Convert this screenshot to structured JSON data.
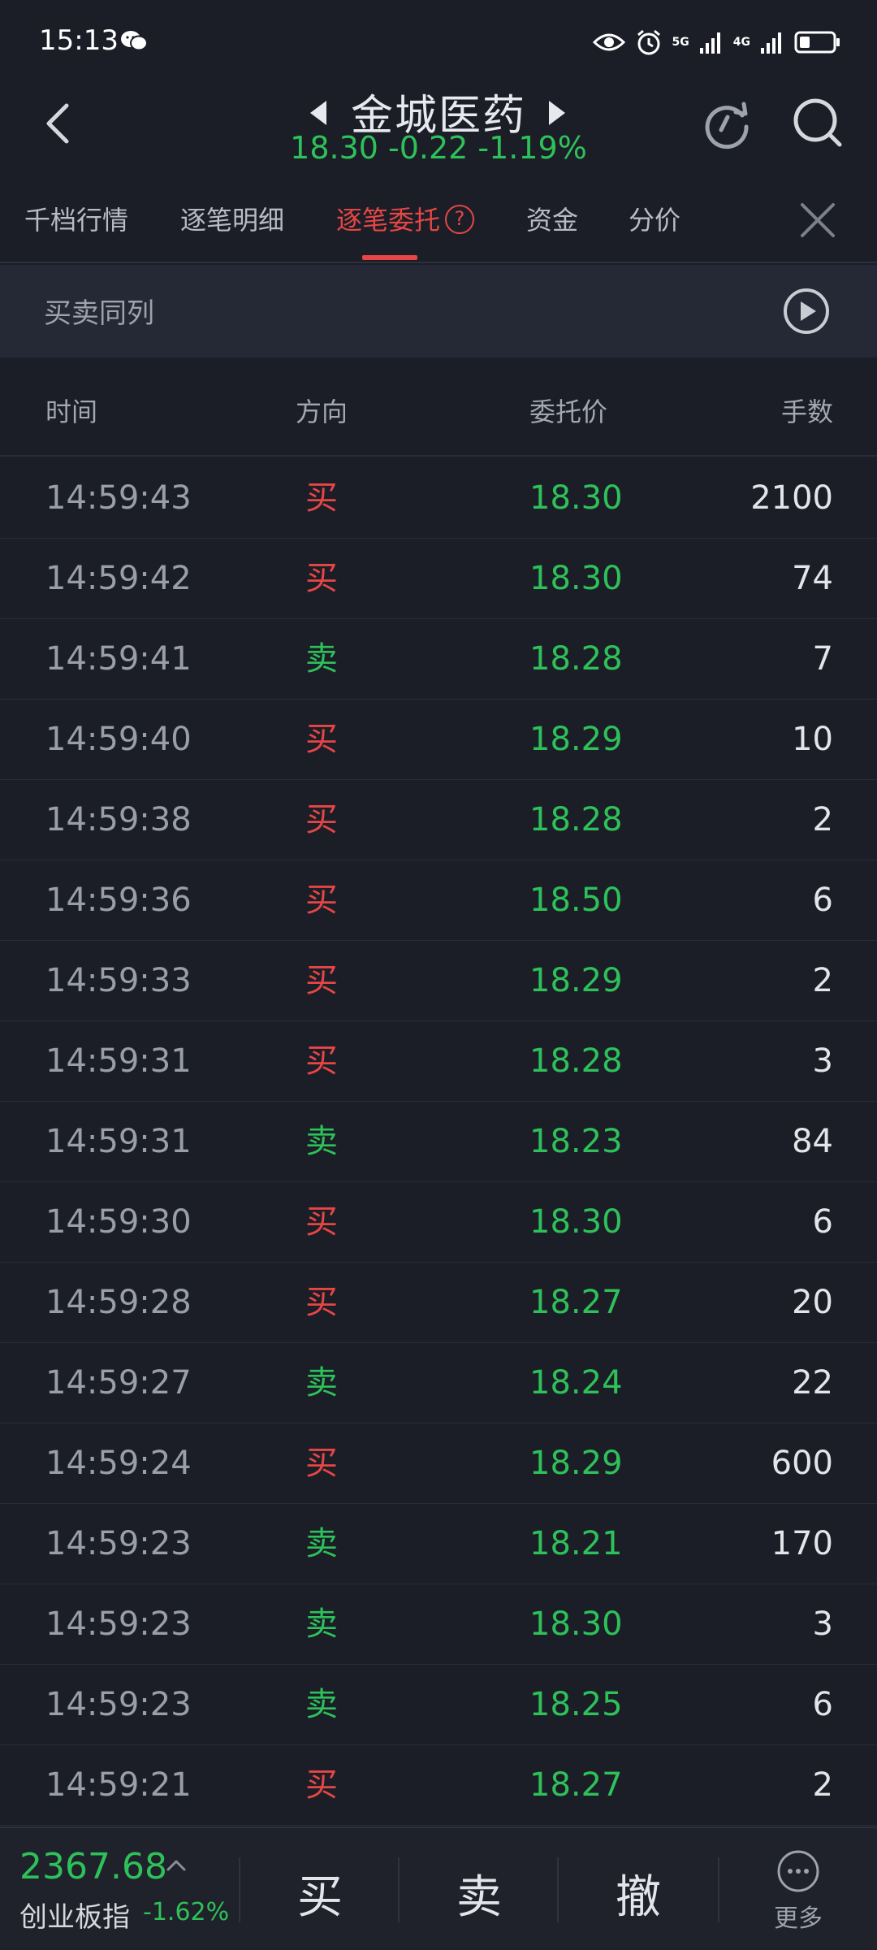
{
  "status_bar": {
    "time": "15:13",
    "net_5g": "5G",
    "net_4g": "4G"
  },
  "header": {
    "stock_name": "金城医药",
    "quote": "18.30 -0.22 -1.19%"
  },
  "tabs": [
    {
      "label": "千档行情"
    },
    {
      "label": "逐笔明细"
    },
    {
      "label": "逐笔委托"
    },
    {
      "label": "资金"
    },
    {
      "label": "分价"
    }
  ],
  "help_glyph": "?",
  "banner": {
    "label": "买卖同列"
  },
  "table": {
    "headers": {
      "time": "时间",
      "direction": "方向",
      "price": "委托价",
      "quantity": "手数"
    },
    "rows": [
      {
        "time": "14:59:43",
        "direction": "买",
        "side": "buy",
        "price": "18.30",
        "quantity": "2100"
      },
      {
        "time": "14:59:42",
        "direction": "买",
        "side": "buy",
        "price": "18.30",
        "quantity": "74"
      },
      {
        "time": "14:59:41",
        "direction": "卖",
        "side": "sell",
        "price": "18.28",
        "quantity": "7"
      },
      {
        "time": "14:59:40",
        "direction": "买",
        "side": "buy",
        "price": "18.29",
        "quantity": "10"
      },
      {
        "time": "14:59:38",
        "direction": "买",
        "side": "buy",
        "price": "18.28",
        "quantity": "2"
      },
      {
        "time": "14:59:36",
        "direction": "买",
        "side": "buy",
        "price": "18.50",
        "quantity": "6"
      },
      {
        "time": "14:59:33",
        "direction": "买",
        "side": "buy",
        "price": "18.29",
        "quantity": "2"
      },
      {
        "time": "14:59:31",
        "direction": "买",
        "side": "buy",
        "price": "18.28",
        "quantity": "3"
      },
      {
        "time": "14:59:31",
        "direction": "卖",
        "side": "sell",
        "price": "18.23",
        "quantity": "84"
      },
      {
        "time": "14:59:30",
        "direction": "买",
        "side": "buy",
        "price": "18.30",
        "quantity": "6"
      },
      {
        "time": "14:59:28",
        "direction": "买",
        "side": "buy",
        "price": "18.27",
        "quantity": "20"
      },
      {
        "time": "14:59:27",
        "direction": "卖",
        "side": "sell",
        "price": "18.24",
        "quantity": "22"
      },
      {
        "time": "14:59:24",
        "direction": "买",
        "side": "buy",
        "price": "18.29",
        "quantity": "600"
      },
      {
        "time": "14:59:23",
        "direction": "卖",
        "side": "sell",
        "price": "18.21",
        "quantity": "170"
      },
      {
        "time": "14:59:23",
        "direction": "卖",
        "side": "sell",
        "price": "18.30",
        "quantity": "3"
      },
      {
        "time": "14:59:23",
        "direction": "卖",
        "side": "sell",
        "price": "18.25",
        "quantity": "6"
      },
      {
        "time": "14:59:21",
        "direction": "买",
        "side": "buy",
        "price": "18.27",
        "quantity": "2"
      }
    ]
  },
  "bottom_bar": {
    "index_value": "2367.68",
    "index_name": "创业板指",
    "index_change": "-1.62%",
    "buy_label": "买",
    "sell_label": "卖",
    "cancel_label": "撤",
    "more_label": "更多"
  },
  "colors": {
    "up": "#e64646",
    "down": "#2ec15a",
    "background": "#1b1e27"
  }
}
